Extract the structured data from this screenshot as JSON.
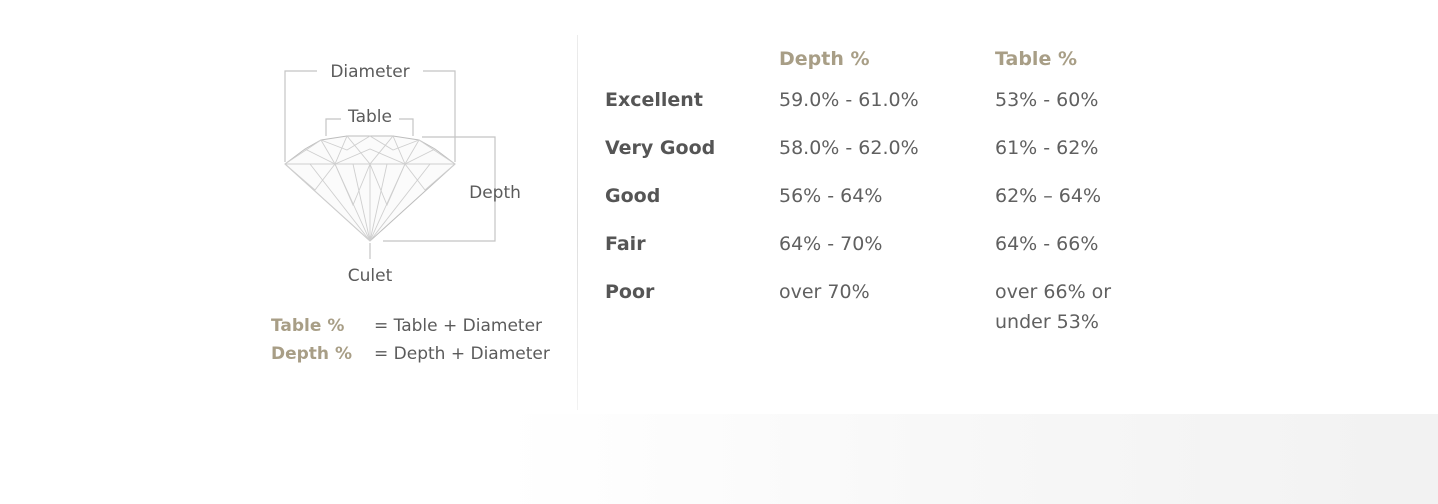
{
  "diagram": {
    "labels": {
      "diameter": "Diameter",
      "table": "Table",
      "depth": "Depth",
      "culet": "Culet"
    },
    "formulas": [
      {
        "term": "Table %",
        "expression": "= Table + Diameter"
      },
      {
        "term": "Depth %",
        "expression": "= Depth + Diameter"
      }
    ]
  },
  "grade_table": {
    "headers": {
      "grade": "",
      "depth": "Depth %",
      "table": "Table %"
    },
    "rows": [
      {
        "grade": "Excellent",
        "depth": "59.0% - 61.0%",
        "table": "53% - 60%"
      },
      {
        "grade": "Very Good",
        "depth": "58.0% - 62.0%",
        "table": "61% - 62%"
      },
      {
        "grade": "Good",
        "depth": "56% - 64%",
        "table": "62% – 64%"
      },
      {
        "grade": "Fair",
        "depth": "64% - 70%",
        "table": "64% - 66%"
      },
      {
        "grade": "Poor",
        "depth": "over 70%",
        "table": "over 66% or under 53%"
      }
    ]
  },
  "colors": {
    "accent": "#a89e86",
    "text": "#606060",
    "line": "#bdbdbd"
  }
}
